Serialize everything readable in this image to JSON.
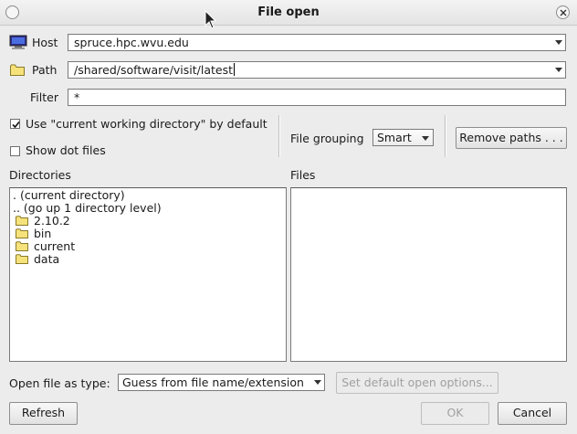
{
  "window": {
    "title": "File open"
  },
  "host": {
    "label": "Host",
    "value": "spruce.hpc.wvu.edu"
  },
  "path": {
    "label": "Path",
    "value": "/shared/software/visit/latest"
  },
  "filter": {
    "label": "Filter",
    "value": "*"
  },
  "options": {
    "use_cwd_label": "Use \"current working directory\" by default",
    "use_cwd_checked": true,
    "show_dot_label": "Show dot files",
    "show_dot_checked": false,
    "file_grouping_label": "File grouping",
    "file_grouping_value": "Smart",
    "remove_paths_label": "Remove paths . . ."
  },
  "directories": {
    "header": "Directories",
    "special": [
      ". (current directory)",
      ".. (go up 1 directory level)"
    ],
    "folders": [
      "2.10.2",
      "bin",
      "current",
      "data"
    ]
  },
  "files": {
    "header": "Files",
    "items": []
  },
  "open_as": {
    "label": "Open file as type:",
    "value": "Guess from file name/extension",
    "default_options_label": "Set default open options..."
  },
  "buttons": {
    "refresh": "Refresh",
    "ok": "OK",
    "cancel": "Cancel"
  },
  "colors": {
    "folder": "#f5e27a",
    "folder_outline": "#8a7a2a",
    "window_bg": "#ececec"
  }
}
